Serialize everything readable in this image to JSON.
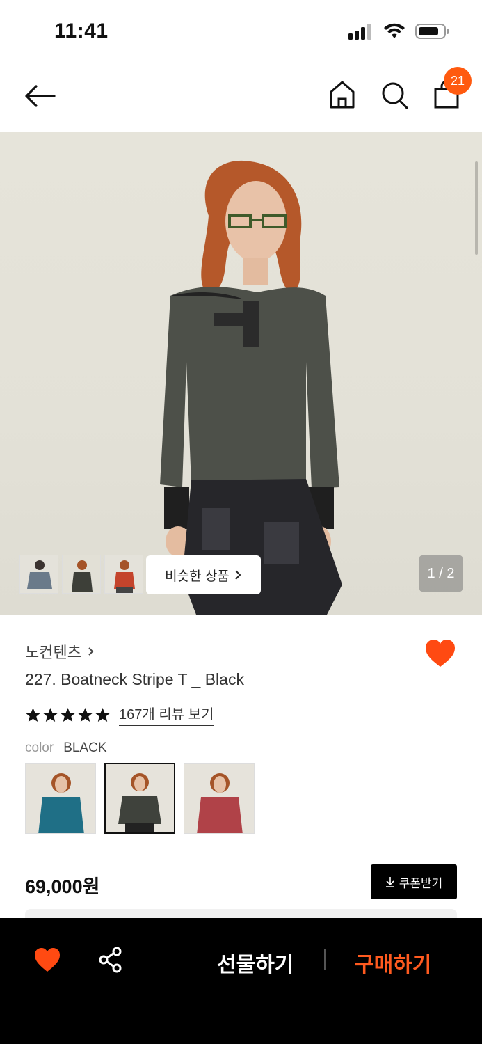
{
  "status_bar": {
    "time": "11:41"
  },
  "header": {
    "cart_count": "21"
  },
  "gallery": {
    "similar_label": "비슷한 상품",
    "page_counter": "1 / 2"
  },
  "product": {
    "brand": "노컨텐츠",
    "title": "227. Boatneck Stripe T _ Black",
    "rating_stars": 5,
    "review_link": "167개 리뷰 보기",
    "color_label": "color",
    "color_value": "BLACK",
    "price": "69,000원",
    "coupon_label": "쿠폰받기"
  },
  "bottom_bar": {
    "gift_label": "선물하기",
    "buy_label": "구매하기"
  },
  "colors": {
    "accent": "#ff5a0f",
    "buy": "#ff5a1f",
    "bar": "#000000"
  }
}
